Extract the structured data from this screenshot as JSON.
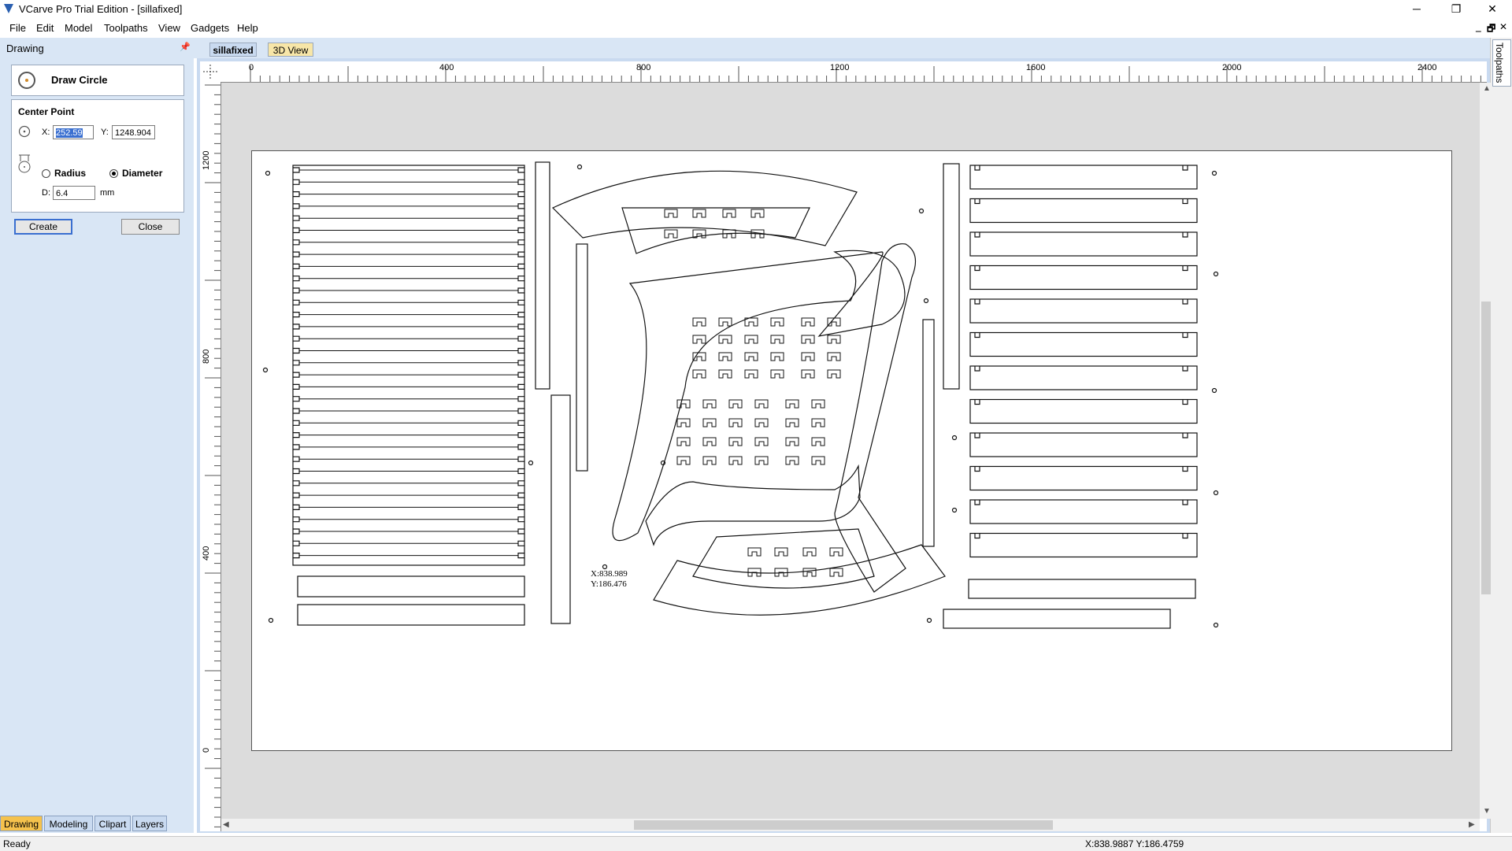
{
  "window": {
    "title": "VCarve Pro Trial Edition - [sillafixed]",
    "minimize": "─",
    "maximize": "❐",
    "close": "✕",
    "mdi_min": "‗",
    "mdi_restore": "🗗",
    "mdi_close": "✕"
  },
  "menu": [
    "File",
    "Edit",
    "Model",
    "Toolpaths",
    "View",
    "Gadgets",
    "Help"
  ],
  "left_panel": {
    "title": "Drawing",
    "pin": "📌",
    "tool_name": "Draw Circle",
    "center_point_label": "Center Point",
    "x_label": "X:",
    "x_value": "252.59",
    "y_label": "Y:",
    "y_value": "1248.904",
    "radius_label": "Radius",
    "diameter_label": "Diameter",
    "diameter_selected": true,
    "d_label": "D:",
    "d_value": "6.4",
    "unit": "mm",
    "create_label": "Create",
    "close_label": "Close",
    "tabs": [
      "Drawing",
      "Modeling",
      "Clipart",
      "Layers"
    ],
    "active_tab": "Drawing"
  },
  "doc_tabs": [
    {
      "label": "sillafixed",
      "active": true
    },
    {
      "label": "3D View",
      "active": false
    }
  ],
  "right_strip_label": "Toolpaths",
  "rulers": {
    "horizontal": [
      "0",
      "400",
      "800",
      "1200",
      "1600",
      "2000",
      "2400"
    ],
    "vertical": [
      "1200",
      "800",
      "400",
      "0"
    ]
  },
  "canvas": {
    "cursor_x": "X:838.989",
    "cursor_y": "Y:186.476"
  },
  "status": {
    "left": "Ready",
    "coords": "X:838.9887 Y:186.4759"
  },
  "colors": {
    "panel_bg": "#d9e6f5",
    "active_tab": "#f5c24d",
    "selection": "#3a6fd0"
  }
}
